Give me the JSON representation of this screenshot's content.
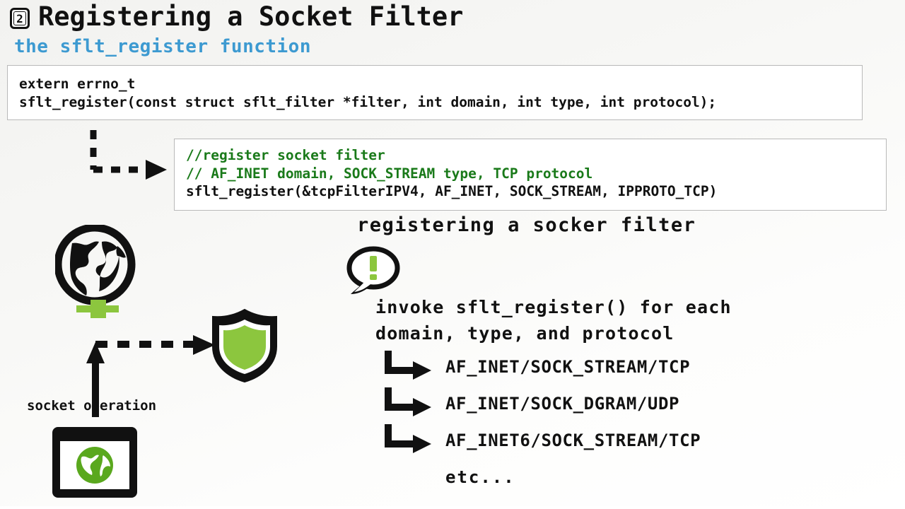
{
  "slide": {
    "badge_number": "2",
    "title": "Registering a Socket Filter",
    "subtitle": "the sflt_register function"
  },
  "declaration_box": {
    "line1": "extern errno_t",
    "line2": "sflt_register(const struct sflt_filter *filter, int domain, int type, int protocol);"
  },
  "usage_box": {
    "comment1": "//register socket filter",
    "comment2": "// AF_INET domain, SOCK_STREAM type, TCP protocol",
    "code": "sflt_register(&tcpFilterIPV4, AF_INET, SOCK_STREAM, IPPROTO_TCP)",
    "comment_color": "#1a7a1a",
    "code_color": "#111111"
  },
  "diagram": {
    "socket_operation_label": "socket operation",
    "globe_icon_name": "globe-icon",
    "shield_icon_name": "shield-icon",
    "browser_icon_name": "browser-window-icon",
    "accent_green": "#8cc63e"
  },
  "notes": {
    "heading": "registering a socker filter",
    "body": "invoke sflt_register() for each domain, type, and protocol",
    "etc": "etc...",
    "items": [
      "AF_INET/SOCK_STREAM/TCP",
      "AF_INET/SOCK_DGRAM/UDP",
      "AF_INET6/SOCK_STREAM/TCP"
    ]
  },
  "theme": {
    "accent_blue": "#3d9ad1",
    "accent_green": "#8cc63e",
    "comment_green": "#1a7a1a",
    "text_black": "#111111",
    "box_border": "#b9b9b9"
  }
}
